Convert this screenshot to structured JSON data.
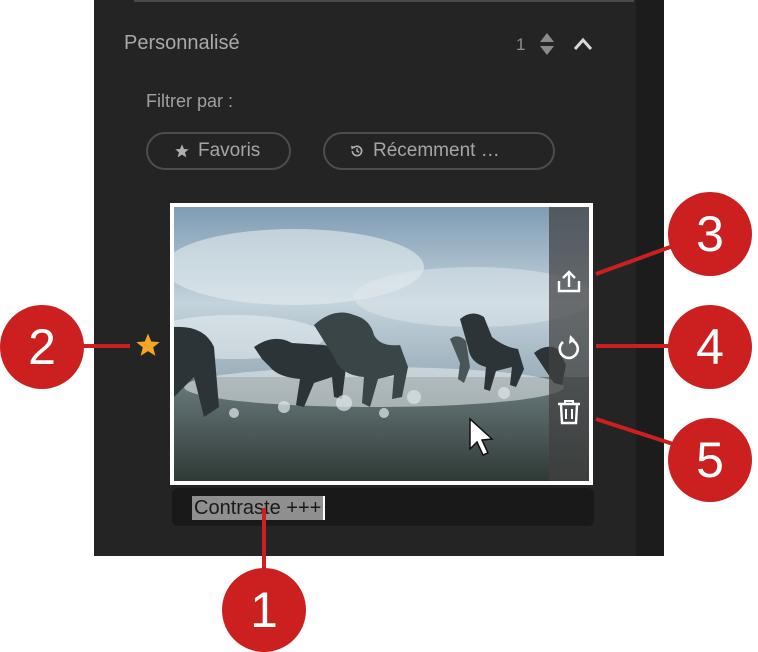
{
  "section": {
    "title": "Personnalisé",
    "count": "1"
  },
  "filter": {
    "label": "Filtrer par :",
    "chips": [
      {
        "label": "Favoris",
        "icon": "star-icon"
      },
      {
        "label": "Récemment …",
        "icon": "history-icon"
      }
    ]
  },
  "preset": {
    "name": "Contraste +++",
    "favorite": true,
    "actions": [
      "share-icon",
      "reset-icon",
      "trash-icon"
    ]
  },
  "callouts": [
    "1",
    "2",
    "3",
    "4",
    "5"
  ],
  "colors": {
    "panel": "#242424",
    "callout": "#cc1f1f",
    "star": "#f5a623",
    "text": "#a9a9a9"
  }
}
